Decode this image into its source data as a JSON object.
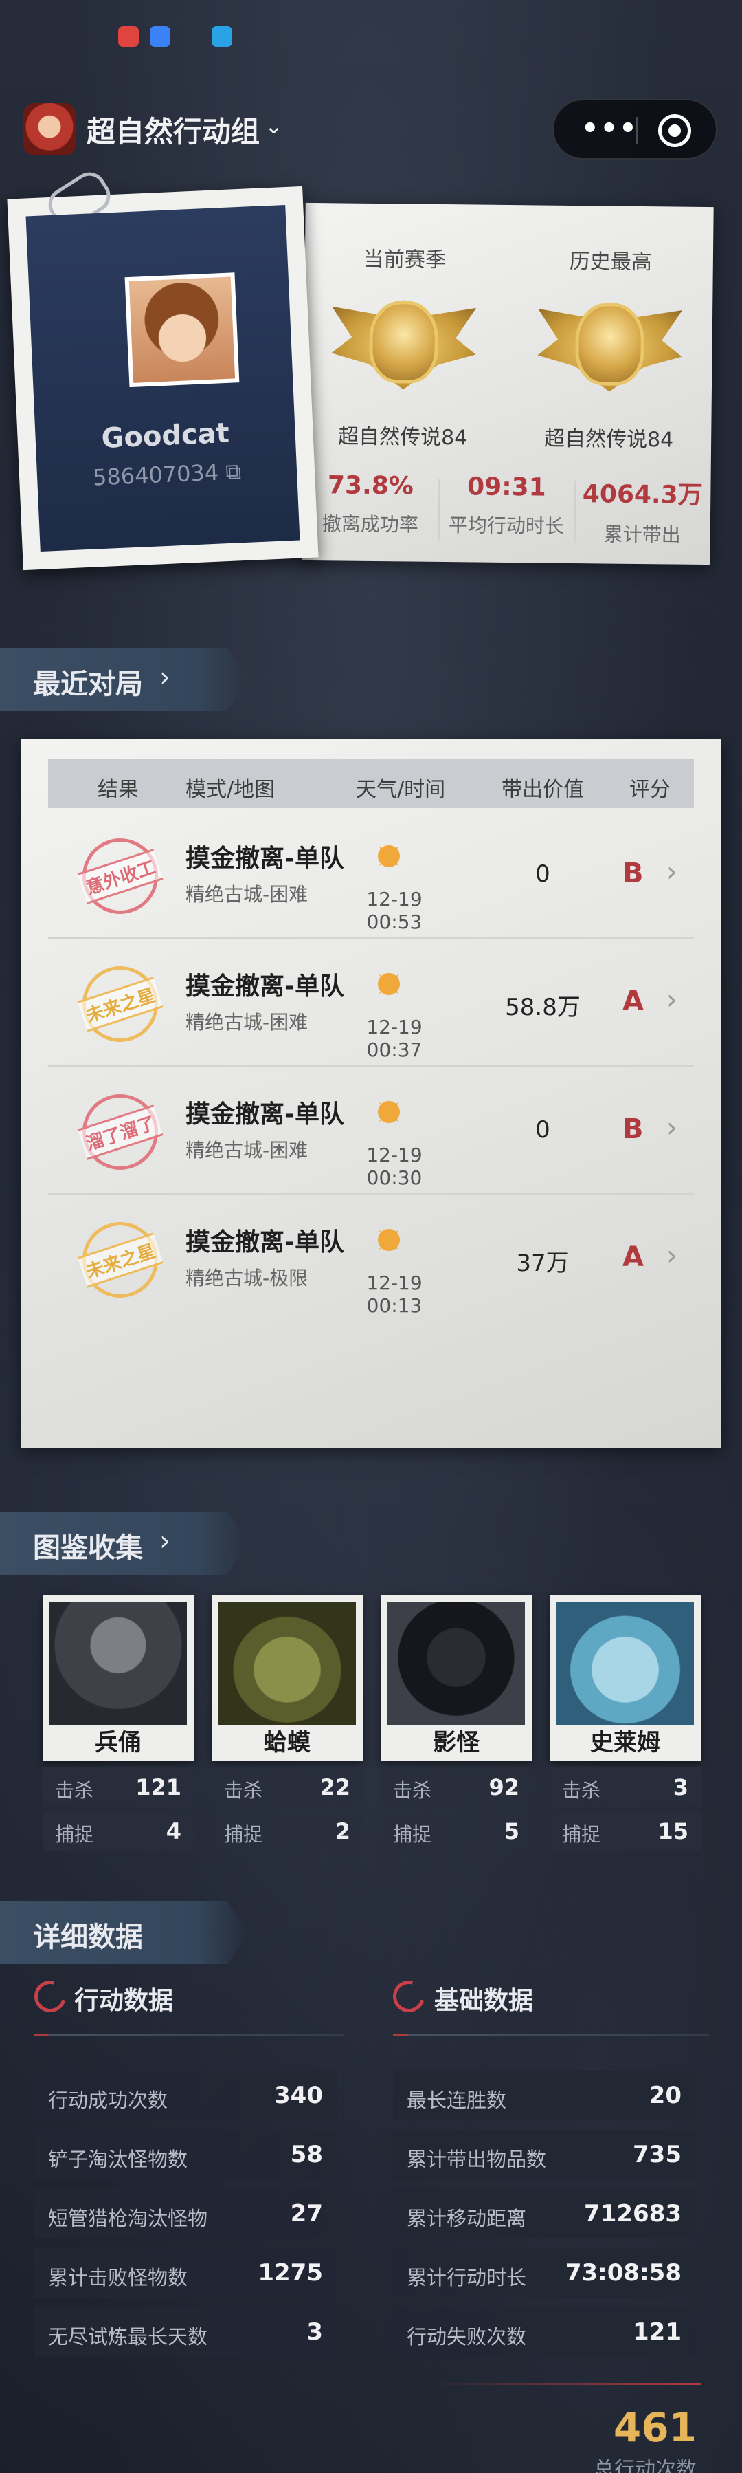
{
  "app": {
    "title": "超自然行动组"
  },
  "profile": {
    "name": "Goodcat",
    "id": "586407034",
    "current_season_label": "当前赛季",
    "current_season_rank": "超自然传说84",
    "history_best_label": "历史最高",
    "history_best_rank": "超自然传说84",
    "stats": [
      {
        "value": "73.8%",
        "label": "撤离成功率"
      },
      {
        "value": "09:31",
        "label": "平均行动时长"
      },
      {
        "value": "4064.3万",
        "label": "累计带出"
      }
    ]
  },
  "recent": {
    "title": "最近对局",
    "headers": {
      "result": "结果",
      "mode": "模式/地图",
      "weather": "天气/时间",
      "value": "带出价值",
      "grade": "评分"
    },
    "rows": [
      {
        "stamp": "意外收工",
        "stamp_color": "#df6b76",
        "mode": "摸金撤离-单队",
        "map": "精绝古城-困难",
        "time": "12-19 00:53",
        "value": "0",
        "grade": "B"
      },
      {
        "stamp": "未来之星",
        "stamp_color": "#e5ad3f",
        "mode": "摸金撤离-单队",
        "map": "精绝古城-困难",
        "time": "12-19 00:37",
        "value": "58.8万",
        "grade": "A"
      },
      {
        "stamp": "溜了溜了",
        "stamp_color": "#df6b76",
        "mode": "摸金撤离-单队",
        "map": "精绝古城-困难",
        "time": "12-19 00:30",
        "value": "0",
        "grade": "B"
      },
      {
        "stamp": "未来之星",
        "stamp_color": "#e5ad3f",
        "mode": "摸金撤离-单队",
        "map": "精绝古城-极限",
        "time": "12-19 00:13",
        "value": "37万",
        "grade": "A"
      }
    ]
  },
  "collection": {
    "title": "图鉴收集",
    "kill_label": "击杀",
    "capture_label": "捕捉",
    "monsters": [
      {
        "name": "兵俑",
        "kills": "121",
        "captures": "4"
      },
      {
        "name": "蛤蟆",
        "kills": "22",
        "captures": "2"
      },
      {
        "name": "影怪",
        "kills": "92",
        "captures": "5"
      },
      {
        "name": "史莱姆",
        "kills": "3",
        "captures": "15"
      }
    ]
  },
  "details": {
    "title": "详细数据",
    "action": {
      "title": "行动数据",
      "rows": [
        {
          "label": "行动成功次数",
          "value": "340"
        },
        {
          "label": "铲子淘汰怪物数",
          "value": "58"
        },
        {
          "label": "短管猎枪淘汰怪物",
          "value": "27"
        },
        {
          "label": "累计击败怪物数",
          "value": "1275"
        },
        {
          "label": "无尽试炼最长天数",
          "value": "3"
        }
      ]
    },
    "basic": {
      "title": "基础数据",
      "rows": [
        {
          "label": "最长连胜数",
          "value": "20"
        },
        {
          "label": "累计带出物品数",
          "value": "735"
        },
        {
          "label": "累计移动距离",
          "value": "712683"
        },
        {
          "label": "累计行动时长",
          "value": "73:08:58"
        },
        {
          "label": "行动失败次数",
          "value": "121"
        }
      ]
    },
    "total": {
      "value": "461",
      "label": "总行动次数"
    }
  },
  "colors": {
    "accent_red": "#b13a3f",
    "gold": "#e6b55a",
    "background": "#1d2230"
  }
}
